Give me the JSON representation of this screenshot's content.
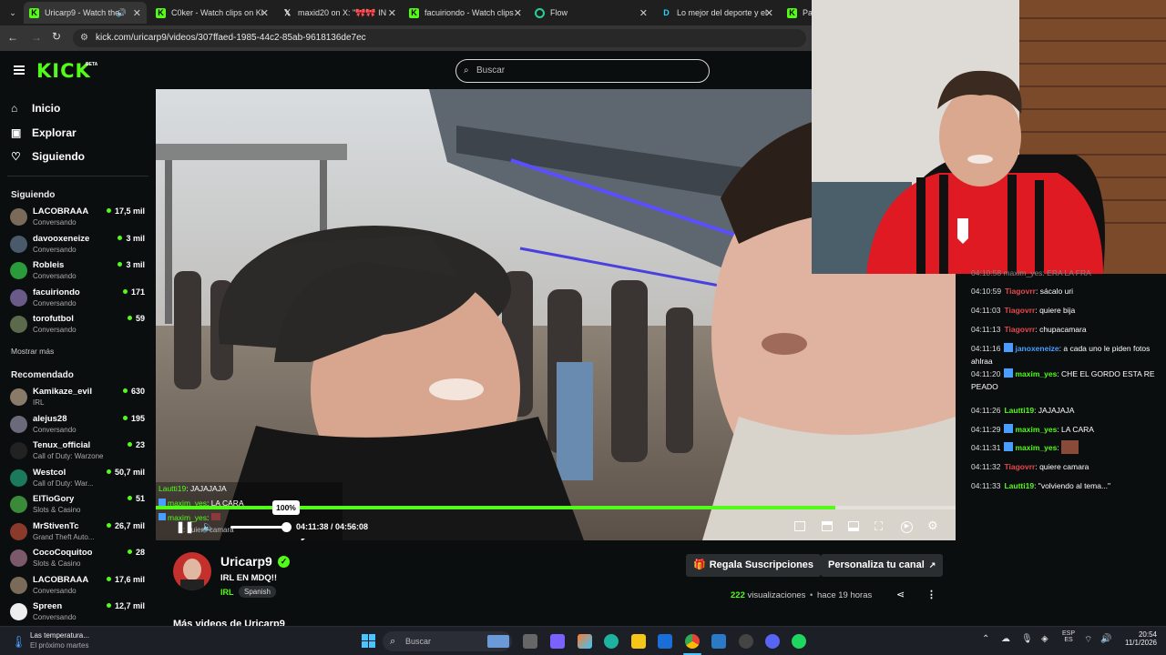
{
  "browser": {
    "tabs": [
      {
        "label": "Uricarp9 - Watch the",
        "icon": "kick-favicon",
        "active": true
      },
      {
        "label": "C0ker - Watch clips on Ki",
        "icon": "kick-favicon"
      },
      {
        "label": "maxid20 on X: \"🎀🎀 IN",
        "icon": "x-favicon"
      },
      {
        "label": "facuiriondo - Watch clips",
        "icon": "kick-favicon"
      },
      {
        "label": "Flow",
        "icon": "flow-favicon"
      },
      {
        "label": "Lo mejor del deporte y el",
        "icon": "disney-favicon"
      },
      {
        "label": "Par",
        "icon": "kick-favicon"
      }
    ],
    "url": "kick.com/uricarp9/videos/307ffaed-1985-44c2-85ab-9618136de7ec"
  },
  "header": {
    "logo": "KICK",
    "logo_badge": "BETA",
    "search_placeholder": "Buscar"
  },
  "sidebar": {
    "nav": [
      {
        "label": "Inicio",
        "icon": "home-icon"
      },
      {
        "label": "Explorar",
        "icon": "compass-icon"
      },
      {
        "label": "Siguiendo",
        "icon": "heart-icon"
      }
    ],
    "following_title": "Siguiendo",
    "following": [
      {
        "name": "LACOBRAAA",
        "category": "Conversando",
        "viewers": "17,5 mil",
        "color": "#7a6a5a"
      },
      {
        "name": "davooxeneize",
        "category": "Conversando",
        "viewers": "3 mil",
        "color": "#4a5a6a"
      },
      {
        "name": "Robleis",
        "category": "Conversando",
        "viewers": "3 mil",
        "color": "#2a9a3a"
      },
      {
        "name": "facuiriondo",
        "category": "Conversando",
        "viewers": "171",
        "color": "#6a5a8a"
      },
      {
        "name": "torofutbol",
        "category": "Conversando",
        "viewers": "59",
        "color": "#5a6a4a"
      }
    ],
    "show_more": "Mostrar más",
    "recommended_title": "Recomendado",
    "recommended": [
      {
        "name": "Kamikaze_evil",
        "category": "IRL",
        "viewers": "630",
        "color": "#8a7a6a"
      },
      {
        "name": "alejus28",
        "category": "Conversando",
        "viewers": "195",
        "color": "#6a6a7a"
      },
      {
        "name": "Tenux_official",
        "category": "Call of Duty: Warzone",
        "viewers": "23",
        "color": "#222222"
      },
      {
        "name": "Westcol",
        "category": "Call of Duty: War...",
        "viewers": "50,7 mil",
        "color": "#1a7a5a"
      },
      {
        "name": "ElTioGory",
        "category": "Slots & Casino",
        "viewers": "51",
        "color": "#3a8a3a"
      },
      {
        "name": "MrStivenTc",
        "category": "Grand Theft Auto...",
        "viewers": "26,7 mil",
        "color": "#8a3a2a"
      },
      {
        "name": "CocoCoquitoo",
        "category": "Slots & Casino",
        "viewers": "28",
        "color": "#7a5a6a"
      },
      {
        "name": "LACOBRAAA",
        "category": "Conversando",
        "viewers": "17,6 mil",
        "color": "#7a6a5a"
      },
      {
        "name": "Spreen",
        "category": "Conversando",
        "viewers": "12,7 mil",
        "color": "#eeeeee"
      }
    ]
  },
  "player": {
    "overlay_chat": [
      {
        "user": "Lautti19",
        "text": ": JAJAJAJA"
      },
      {
        "user": "maxim_yes",
        "text": ": LA CARA"
      },
      {
        "user": "maxim_yes",
        "text": ":"
      }
    ],
    "overlay_partial": ": quiere camara",
    "volume_tooltip": "100%",
    "volume": 1.0,
    "time": "04:11:38 / 04:56:08",
    "progress": 0.85
  },
  "chat": {
    "partial_top": "04:10:58  maxim_yes: ERA LA FRA",
    "messages": [
      {
        "time": "04:10:59",
        "user": "Tiagovrr",
        "user_color": "#e5484d",
        "badge": false,
        "text": "sácalo uri"
      },
      {
        "time": "04:11:03",
        "user": "Tiagovrr",
        "user_color": "#e5484d",
        "badge": false,
        "text": "quiere bija"
      },
      {
        "time": "04:11:13",
        "user": "Tiagovrr",
        "user_color": "#e5484d",
        "badge": false,
        "text": "chupacamara"
      },
      {
        "time": "04:11:16",
        "user": "janoxeneize",
        "user_color": "#4a9eff",
        "badge": true,
        "text": "a cada uno le piden fotos ahlraa"
      },
      {
        "time": "04:11:20",
        "user": "maxim_yes",
        "user_color": "#53fc18",
        "badge": true,
        "text": "CHE EL GORDO ESTA RE PEADO"
      },
      {
        "time": "04:11:26",
        "user": "Lautti19",
        "user_color": "#53fc18",
        "badge": false,
        "text": "JAJAJAJA"
      },
      {
        "time": "04:11:29",
        "user": "maxim_yes",
        "user_color": "#53fc18",
        "badge": true,
        "text": "LA CARA"
      },
      {
        "time": "04:11:31",
        "user": "maxim_yes",
        "user_color": "#53fc18",
        "badge": true,
        "text": ""
      },
      {
        "time": "04:11:32",
        "user": "Tiagovrr",
        "user_color": "#e5484d",
        "badge": false,
        "text": "quiere camara"
      },
      {
        "time": "04:11:33",
        "user": "Lautti19",
        "user_color": "#53fc18",
        "badge": false,
        "text": "\"volviendo al tema...\""
      }
    ]
  },
  "stream_info": {
    "channel": "Uricarp9",
    "title": "IRL EN MDQ!!",
    "category": "IRL",
    "tag": "Spanish",
    "gift_button": "Regala Suscripciones",
    "customize_button": "Personaliza tu canal",
    "views_count": "222",
    "views_label": "visualizaciones",
    "published": "hace 19 horas",
    "more_videos_partial": "Más videos de Uricarp9"
  },
  "taskbar": {
    "weather_title": "Las temperatura...",
    "weather_sub": "El próximo martes",
    "search_placeholder": "Buscar",
    "lang_top": "ESP",
    "lang_bottom": "ES",
    "time": "20:54",
    "date": "11/1/2026"
  },
  "colors": {
    "kick_green": "#53fc18",
    "background": "#0b0e0f"
  }
}
